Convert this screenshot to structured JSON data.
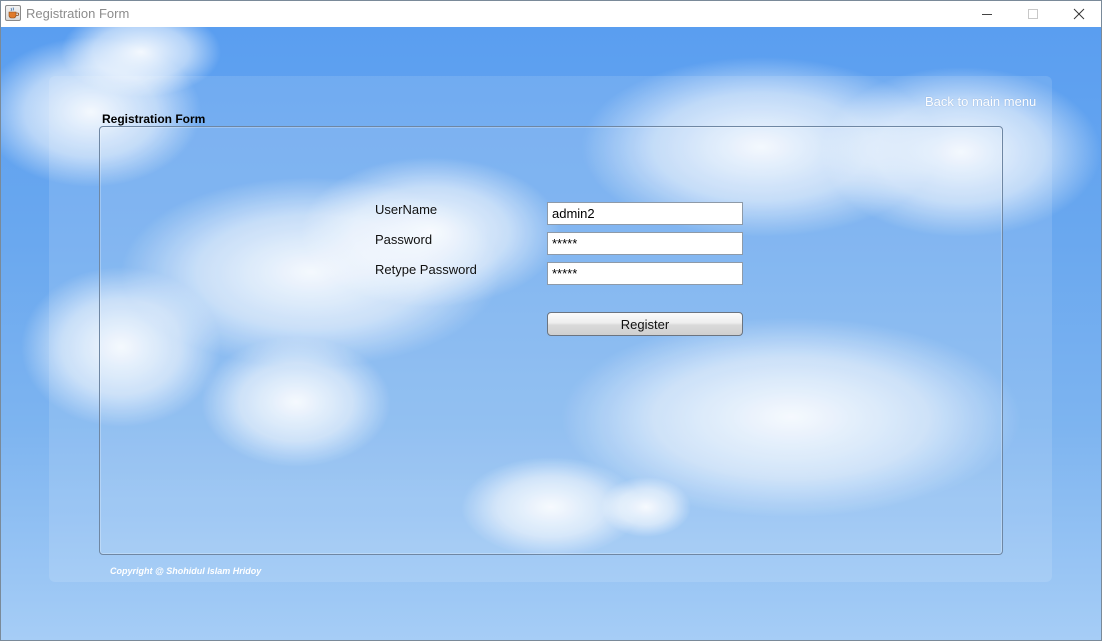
{
  "window": {
    "title": "Registration Form",
    "icon": "java-cup-icon",
    "controls": {
      "minimize": "minimize-icon",
      "maximize": "maximize-icon",
      "close": "close-icon"
    }
  },
  "header": {
    "back_link": "Back to main menu"
  },
  "form": {
    "title": "Registration Form",
    "username_label": "UserName",
    "username_value": "admin2",
    "password_label": "Password",
    "password_value": "*****",
    "retype_label": "Retype Password",
    "retype_value": "*****",
    "register_label": "Register"
  },
  "footer": {
    "copyright": "Copyright @ Shohidul Islam Hridoy"
  },
  "colors": {
    "sky_top": "#5a9ef0",
    "sky_bottom": "#a6cdf6",
    "link_text": "#ffffff"
  }
}
